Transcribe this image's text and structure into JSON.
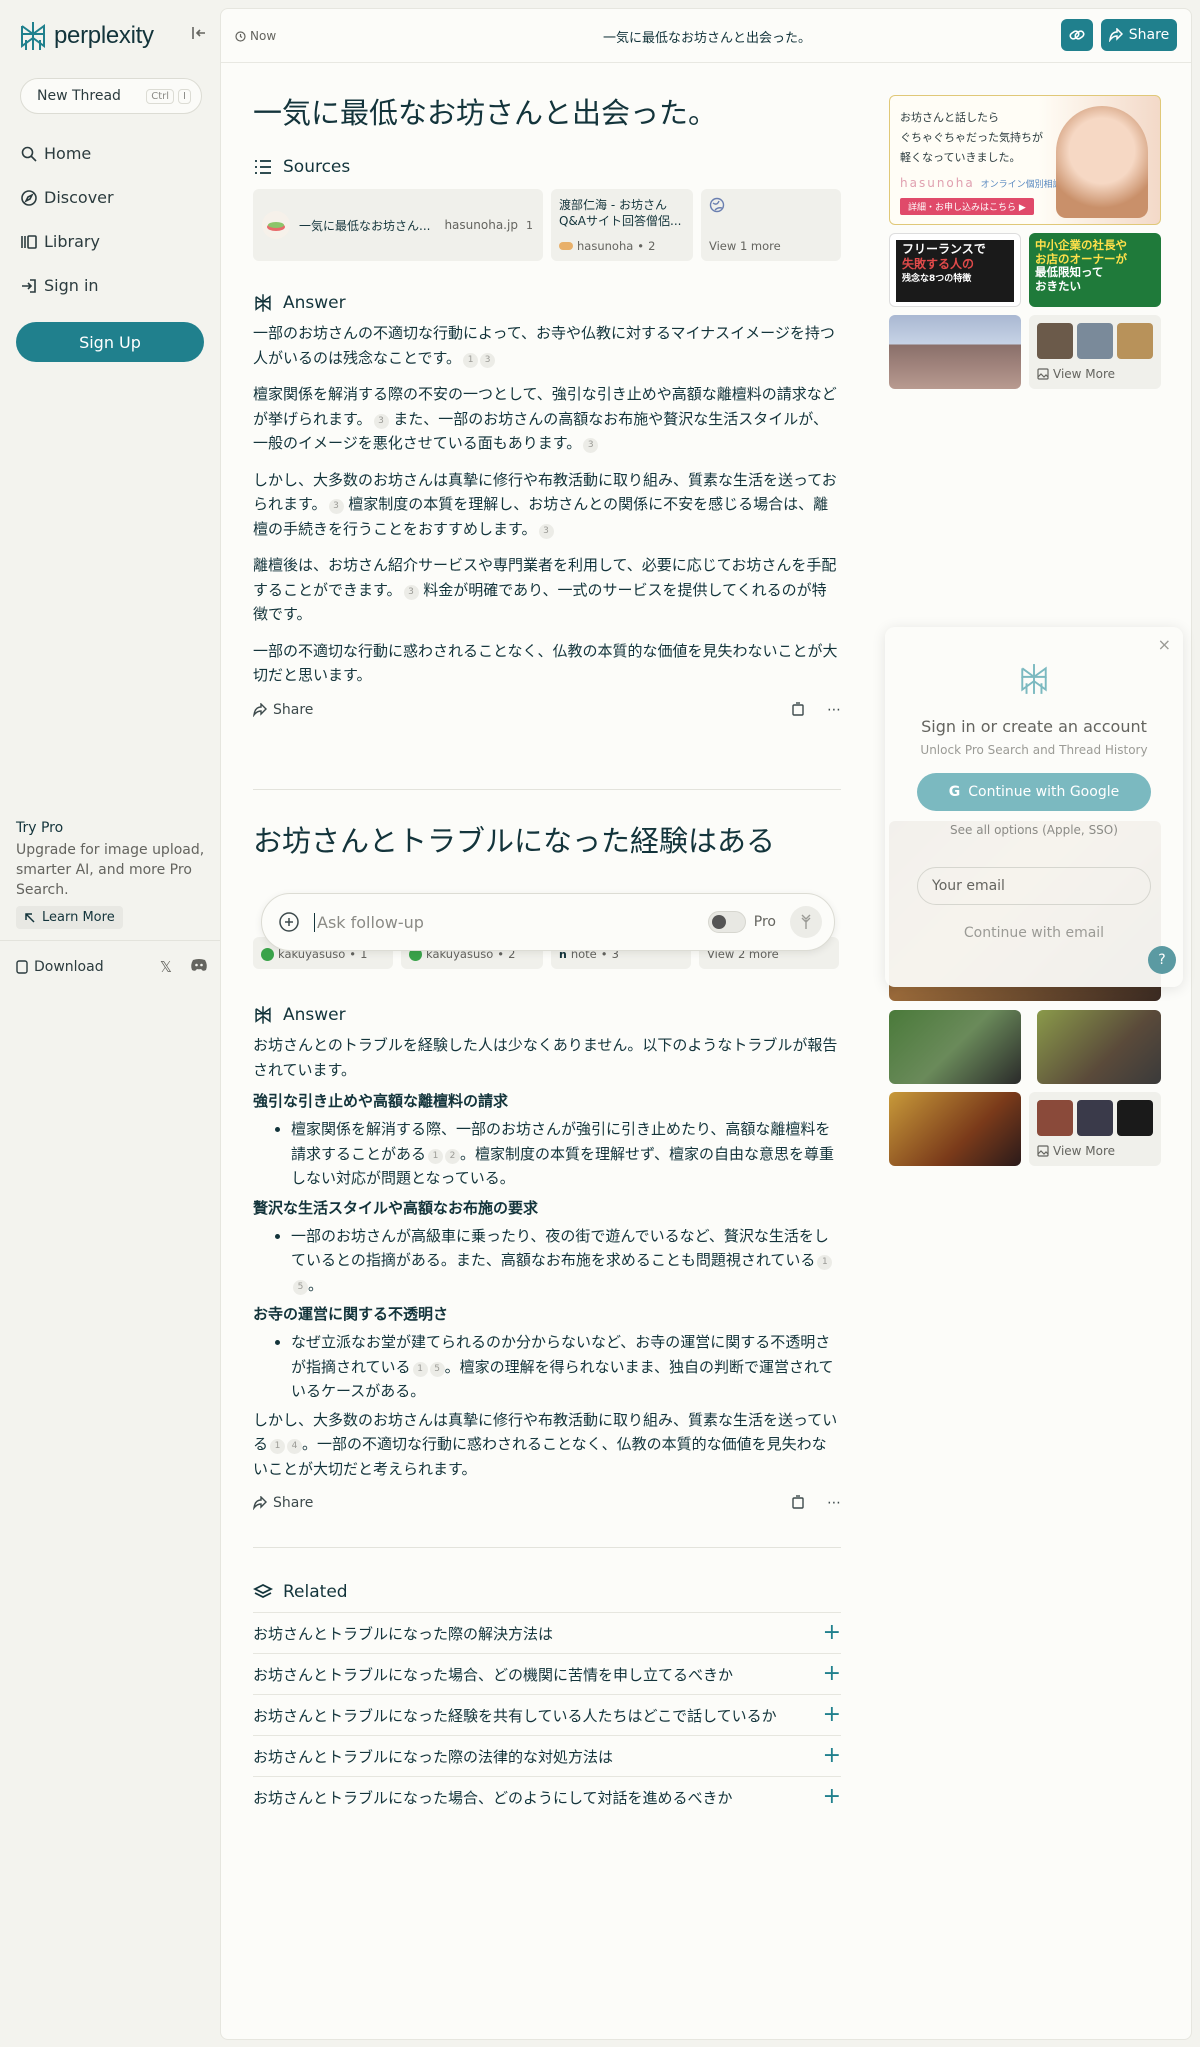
{
  "sidebar": {
    "logo_text": "perplexity",
    "new_thread": "New Thread",
    "kbd": [
      "Ctrl",
      "I"
    ],
    "nav": [
      "Home",
      "Discover",
      "Library",
      "Sign in"
    ],
    "signup": "Sign Up",
    "try_pro_title": "Try Pro",
    "try_pro_desc": "Upgrade for image upload, smarter AI, and more Pro Search.",
    "learn_more": "Learn More",
    "download": "Download"
  },
  "topbar": {
    "time": "Now",
    "title": "一気に最低なお坊さんと出会った。",
    "share": "Share"
  },
  "thread1": {
    "question": "一気に最低なお坊さんと出会った。",
    "sources_label": "Sources",
    "sources": [
      {
        "title": "一気に最低なお坊さん...",
        "domain": "hasunoha.jp",
        "num": "1"
      },
      {
        "title": "渡部仁海 - お坊さん Q&Aサイト回答僧侶...",
        "domain": "hasunoha",
        "num": "2"
      },
      {
        "title": "View 1 more"
      }
    ],
    "answer_label": "Answer",
    "paragraphs": [
      {
        "text": "一部のお坊さんの不適切な行動によって、お寺や仏教に対するマイナスイメージを持つ人がいるのは残念なことです。",
        "cites": [
          "1",
          "3"
        ]
      },
      {
        "text_a": "檀家関係を解消する際の不安の一つとして、強引な引き止めや高額な離檀料の請求などが挙げられます。",
        "cite_a": "3",
        "text_b": "また、一部のお坊さんの高額なお布施や贅沢な生活スタイルが、一般のイメージを悪化させている面もあります。",
        "cite_b": "3"
      },
      {
        "text_a": "しかし、大多数のお坊さんは真摯に修行や布教活動に取り組み、質素な生活を送っておられます。",
        "cite_a": "3",
        "text_b": "檀家制度の本質を理解し、お坊さんとの関係に不安を感じる場合は、離檀の手続きを行うことをおすすめします。",
        "cite_b": "3"
      },
      {
        "text_a": "離檀後は、お坊さん紹介サービスや専門業者を利用して、必要に応じてお坊さんを手配することができます。",
        "cite_a": "3",
        "text_b": "料金が明確であり、一式のサービスを提供してくれるのが特徴です。"
      },
      {
        "text": "一部の不適切な行動に惑わされることなく、仏教の本質的な価値を見失わないことが大切だと思います。"
      }
    ],
    "share": "Share"
  },
  "thread2": {
    "question": "お坊さんとトラブルになった経験はある",
    "sources": [
      {
        "domain": "kakuyasuso",
        "num": "1"
      },
      {
        "domain": "kakuyasuso",
        "num": "2"
      },
      {
        "domain": "note",
        "num": "3"
      },
      {
        "title": "View 2 more"
      }
    ],
    "answer_label": "Answer",
    "intro": "お坊さんとのトラブルを経験した人は少なくありません。以下のようなトラブルが報告されています。",
    "sections": [
      {
        "heading": "強引な引き止めや高額な離檀料の請求",
        "a": "檀家関係を解消する際、一部のお坊さんが強引に引き止めたり、高額な離檀料を請求することがある",
        "cites": [
          "1",
          "2"
        ],
        "b": "。檀家制度の本質を理解せず、檀家の自由な意思を尊重しない対応が問題となっている。"
      },
      {
        "heading": "贅沢な生活スタイルや高額なお布施の要求",
        "a": "一部のお坊さんが高級車に乗ったり、夜の街で遊んでいるなど、贅沢な生活をしているとの指摘がある。また、高額なお布施を求めることも問題視されている",
        "cites": [
          "1",
          "5"
        ],
        "b": "。"
      },
      {
        "heading": "お寺の運営に関する不透明さ",
        "a": "なぜ立派なお堂が建てられるのか分からないなど、お寺の運営に関する不透明さが指摘されている",
        "cites": [
          "1",
          "5"
        ],
        "b": "。檀家の理解を得られないまま、独自の判断で運営されているケースがある。"
      }
    ],
    "outro_a": "しかし、大多数のお坊さんは真摯に修行や布教活動に取り組み、質素な生活を送っている",
    "outro_cites": [
      "1",
      "4"
    ],
    "outro_b": "。一部の不適切な行動に惑わされることなく、仏教の本質的な価値を見失わないことが大切だと考えられます。",
    "share": "Share"
  },
  "followup": {
    "placeholder": "Ask follow-up",
    "pro": "Pro"
  },
  "related": {
    "label": "Related",
    "items": [
      "お坊さんとトラブルになった際の解決方法は",
      "お坊さんとトラブルになった場合、どの機関に苦情を申し立てるべきか",
      "お坊さんとトラブルになった経験を共有している人たちはどこで話しているか",
      "お坊さんとトラブルになった際の法律的な対処方法は",
      "お坊さんとトラブルになった場合、どのようにして対話を進めるべきか"
    ]
  },
  "right_images": {
    "ad1": {
      "line1": "お坊さんと話したら",
      "line2": "ぐちゃぐちゃだった気持ちが",
      "line3": "軽くなっていきました。",
      "brand": "hasunoha",
      "brand_sub": "オンライン個別相談",
      "cta": "詳細・お申し込みはこちら ▶"
    },
    "ad2": {
      "line1": "フリーランスで",
      "line2": "失敗する人の",
      "line3": "残念な8つの特徴"
    },
    "ad3": {
      "line1": "中小企業の社長や",
      "line2": "お店のオーナーが",
      "line3": "最低限知って",
      "line4": "おきたい"
    },
    "view_more_1": "View More",
    "view_more_2": "View More"
  },
  "signin": {
    "title": "Sign in or create an account",
    "subtitle": "Unlock Pro Search and Thread History",
    "google": "Continue with Google",
    "see_all": "See all options (Apple, SSO)",
    "email_placeholder": "Your email",
    "continue_email": "Continue with email"
  },
  "colors": {
    "accent": "#20808d",
    "bg": "#f3f3ee",
    "panel": "#fcfcf9"
  }
}
